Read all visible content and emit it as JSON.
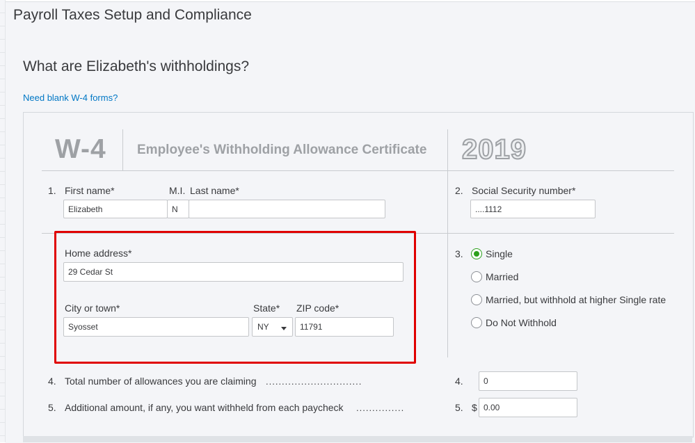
{
  "page": {
    "title": "Payroll Taxes Setup and Compliance",
    "subtitle": "What are Elizabeth's withholdings?",
    "blank_w4_link": "Need blank W-4 forms?"
  },
  "form_header": {
    "form_code": "W-4",
    "form_title": "Employee's Withholding Allowance Certificate",
    "year": "2019"
  },
  "section1": {
    "number": "1.",
    "first_name_label": "First name*",
    "mi_label": "M.I.",
    "last_name_label": "Last name*",
    "first_name_value": "Elizabeth",
    "mi_value": "N",
    "last_name_value": ""
  },
  "section2": {
    "number": "2.",
    "ssn_label": "Social Security number*",
    "ssn_value": "....1112"
  },
  "address": {
    "home_address_label": "Home address*",
    "home_address_value": "29 Cedar St",
    "city_label": "City or town*",
    "city_value": "Syosset",
    "state_label": "State*",
    "state_value": "NY",
    "zip_label": "ZIP code*",
    "zip_value": "11791"
  },
  "section3": {
    "number": "3.",
    "options": [
      {
        "label": "Single",
        "checked": true
      },
      {
        "label": "Married",
        "checked": false
      },
      {
        "label": "Married, but withhold at higher Single rate",
        "checked": false
      },
      {
        "label": "Do Not Withhold",
        "checked": false
      }
    ]
  },
  "section4": {
    "number": "4.",
    "label": "Total number of allowances you are claiming",
    "dots": "..............................",
    "right_number": "4.",
    "value": "0"
  },
  "section5": {
    "number": "5.",
    "label": "Additional amount, if any, you want withheld from each paycheck",
    "dots": "...............",
    "right_number": "5.",
    "currency": "$",
    "value": "0.00"
  },
  "colors": {
    "accent_green": "#2ca01c",
    "link_blue": "#0077c5",
    "highlight_red": "#e00000"
  }
}
